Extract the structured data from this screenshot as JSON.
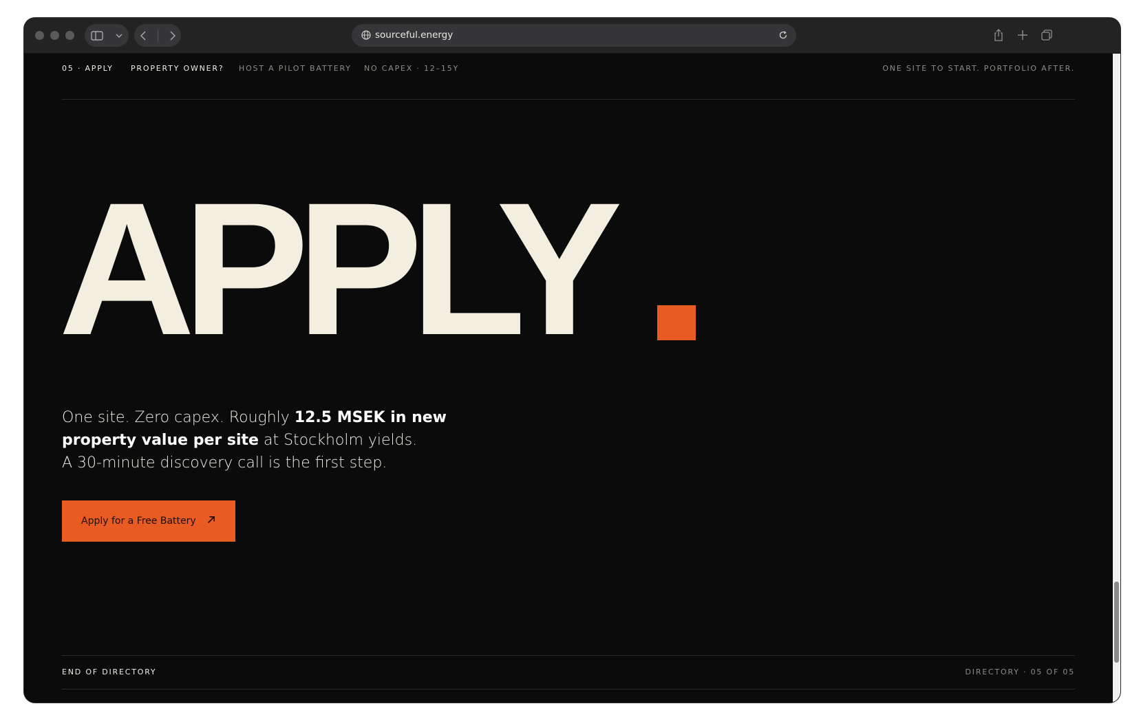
{
  "browser": {
    "url": "sourceful.energy",
    "icons": [
      "sidebar-icon",
      "chevron-down-icon",
      "back-icon",
      "forward-icon",
      "globe-icon",
      "reload-icon",
      "share-icon",
      "new-tab-icon",
      "tabs-overview-icon"
    ]
  },
  "topnav": {
    "section": "05 · APPLY",
    "question": "PROPERTY OWNER?",
    "offer": "HOST A PILOT BATTERY",
    "terms": "NO CAPEX · 12–15Y",
    "tagline": "ONE SITE TO START. PORTFOLIO AFTER."
  },
  "hero": {
    "title": "APPLY",
    "accent_color": "#e85c23"
  },
  "intro": {
    "part1": "One site. Zero capex. Roughly ",
    "highlight": "12.5 MSEK in new property value per site",
    "part2": " at Stockholm yields.",
    "line3": "A 30-minute discovery call is the first step."
  },
  "cta": {
    "label": "Apply for a Free Battery",
    "icon": "arrow-up-right-icon"
  },
  "footer": {
    "left": "END OF DIRECTORY",
    "right": "DIRECTORY · 05 OF 05"
  },
  "colors": {
    "background": "#0b0b0b",
    "text": "#f2efe1",
    "accent": "#e85c23"
  }
}
